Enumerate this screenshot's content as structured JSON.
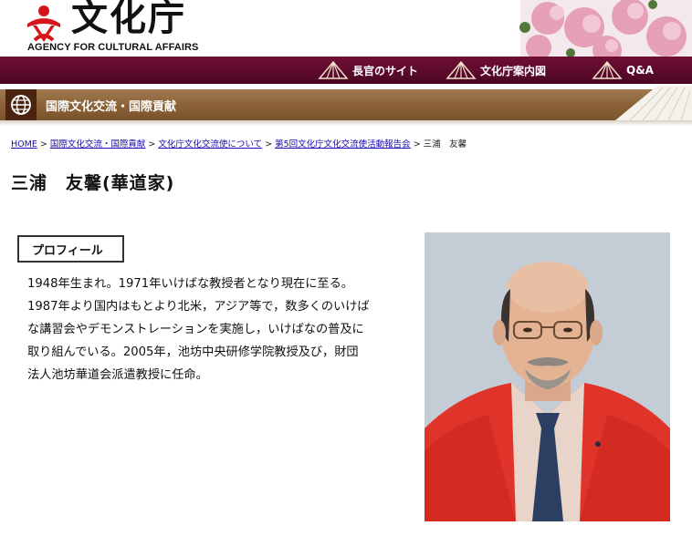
{
  "header": {
    "logo_jp": "文化庁",
    "logo_en": "AGENCY FOR CULTURAL AFFAIRS"
  },
  "topnav": {
    "items": [
      {
        "label": "長官のサイト"
      },
      {
        "label": "文化庁案内図"
      },
      {
        "label": "Q&A"
      }
    ]
  },
  "section": {
    "title": "国際文化交流・国際貢献"
  },
  "breadcrumb": {
    "items": [
      "HOME",
      "国際文化交流・国際貢献",
      "文化庁文化交流使について",
      "第5回文化庁文化交流使活動報告会"
    ],
    "current": "三浦　友馨",
    "separator": ">"
  },
  "page": {
    "title": "三浦　友馨(華道家)"
  },
  "profile": {
    "heading": "プロフィール",
    "lines": [
      "1948年生まれ。1971年いけばな教授者となり現在に至る。",
      "1987年より国内はもとより北米，アジア等で，数多くのいけば",
      "な講習会やデモンストレーションを実施し，いけばなの普及に",
      "取り組んでいる。2005年，池坊中央研修学院教授及び，財団",
      "法人池坊華道会派遣教授に任命。"
    ]
  },
  "colors": {
    "nav_bg": "#5a0a2b",
    "section_bg": "#8a6137",
    "link": "#1a0dab",
    "logo_red": "#d7141a"
  }
}
